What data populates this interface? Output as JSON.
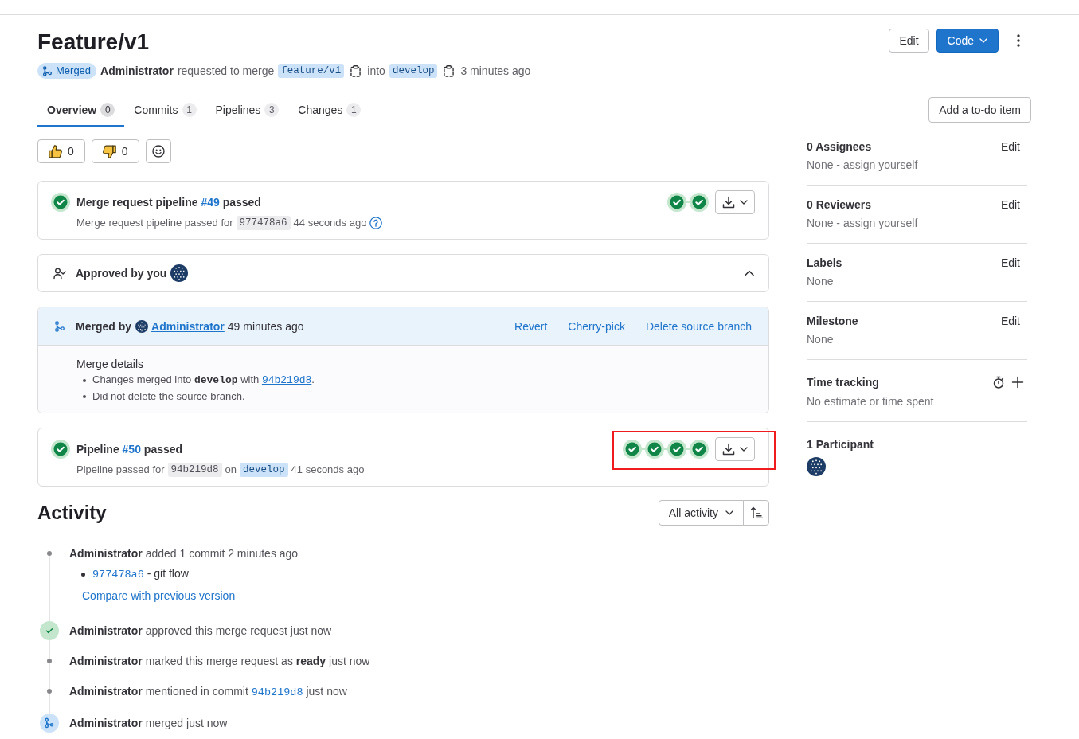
{
  "header": {
    "title": "Feature/v1",
    "actions": [
      {
        "kind": "button",
        "label": "Edit"
      },
      {
        "kind": "primary-dropdown",
        "label": "Code"
      },
      {
        "kind": "more"
      }
    ]
  },
  "meta": {
    "status": "Merged",
    "author": "Administrator",
    "action": "requested to merge",
    "source_branch": "feature/v1",
    "connector": "into",
    "target_branch": "develop",
    "time": "3 minutes ago"
  },
  "tabs": [
    {
      "label": "Overview",
      "count": "0",
      "selected": true
    },
    {
      "label": "Commits",
      "count": "1",
      "selected": false
    },
    {
      "label": "Pipelines",
      "count": "3",
      "selected": false
    },
    {
      "label": "Changes",
      "count": "1",
      "selected": false
    }
  ],
  "todo_button": "Add a to-do item",
  "reactions": [
    {
      "kind": "thumbs-up",
      "count": "0"
    },
    {
      "kind": "thumbs-down",
      "count": "0"
    },
    {
      "kind": "add-emoji"
    }
  ],
  "widgets": [
    {
      "kind": "pipeline",
      "passed": true,
      "title": "Merge request pipeline",
      "link": "#49",
      "title_suffix": "passed",
      "details": [
        {
          "kind": "text",
          "text": "Merge request pipeline passed for"
        },
        {
          "kind": "sha",
          "text": "977478a6"
        },
        {
          "kind": "text",
          "text": "44 seconds ago"
        },
        {
          "kind": "help"
        }
      ],
      "stages": [
        {
          "passed": true
        },
        {
          "passed": true
        }
      ]
    },
    {
      "kind": "approval",
      "text": "Approved by you",
      "expanded": true
    },
    {
      "kind": "merged",
      "label": "Merged by",
      "user": "Administrator",
      "time": "49 minutes ago",
      "actions": [
        "Revert",
        "Cherry-pick",
        "Delete source branch"
      ],
      "details_title": "Merge details",
      "details": [
        {
          "text": "Changes merged into **develop** with",
          "link": "94b219d8",
          "suffix": "."
        },
        {
          "text": "Did not delete the source branch."
        }
      ]
    },
    {
      "kind": "pipeline",
      "passed": true,
      "title": "Pipeline",
      "link": "#50",
      "title_suffix": "passed",
      "details": [
        {
          "kind": "text",
          "text": "Pipeline passed for"
        },
        {
          "kind": "sha",
          "text": "94b219d8"
        },
        {
          "kind": "text",
          "text": "on"
        },
        {
          "kind": "branch",
          "text": "develop"
        },
        {
          "kind": "text",
          "text": "41 seconds ago"
        }
      ],
      "stages": [
        {
          "passed": true
        },
        {
          "passed": true
        },
        {
          "passed": true
        },
        {
          "passed": true
        }
      ],
      "highlighted": true
    }
  ],
  "activity": {
    "title": "Activity",
    "filter": "All activity",
    "items": [
      {
        "kind": "note",
        "text": "**Administrator** added 1 commit 2 minutes ago",
        "commits": [
          {
            "sha": "977478a6",
            "message": "- git flow"
          }
        ],
        "link": "Compare with previous version"
      },
      {
        "kind": "approved",
        "text": "**Administrator** approved this merge request just now"
      },
      {
        "kind": "note",
        "text": "**Administrator** marked this merge request as **ready** just now"
      },
      {
        "kind": "note",
        "text": "**Administrator** mentioned in commit",
        "commit": "94b219d8",
        "suffix": "just now"
      },
      {
        "kind": "merged",
        "text": "**Administrator** merged just now"
      }
    ]
  },
  "sidebar": [
    {
      "kind": "editable",
      "title": "0 Assignees",
      "action": "Edit",
      "value": "None - assign yourself"
    },
    {
      "kind": "editable",
      "title": "0 Reviewers",
      "action": "Edit",
      "value": "None - assign yourself"
    },
    {
      "kind": "editable",
      "title": "Labels",
      "action": "Edit",
      "value": "None"
    },
    {
      "kind": "editable",
      "title": "Milestone",
      "action": "Edit",
      "value": "None"
    },
    {
      "kind": "time",
      "title": "Time tracking",
      "value": "No estimate or time spent"
    },
    {
      "kind": "participants",
      "title": "1 Participant"
    }
  ]
}
